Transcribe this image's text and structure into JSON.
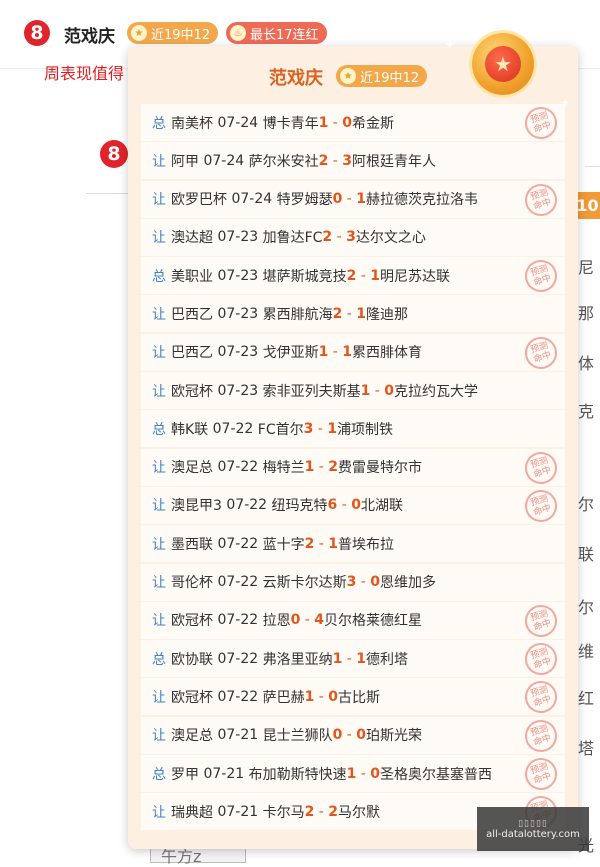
{
  "header": {
    "name": "范戏庆",
    "badge_recent": "近19中12",
    "badge_streak": "最长17连红"
  },
  "background": {
    "red_text": "周表现值得",
    "right_badge": "10",
    "right_chars": [
      "尼",
      "那",
      "体",
      "克",
      "尔",
      "联",
      "尔",
      "维",
      "红",
      "塔",
      "光"
    ],
    "bottom_left": "午方z"
  },
  "popup": {
    "title": "范戏庆",
    "badge": "近19中12",
    "stamp_text": "预测命中",
    "rows": [
      {
        "tag": "总",
        "league": "南美杯",
        "date": "07-24",
        "home": "博卡青年",
        "hs": "1",
        "as": "0",
        "away": "希金斯",
        "hit": true
      },
      {
        "tag": "让",
        "league": "阿甲",
        "date": "07-24",
        "home": "萨尔米安社",
        "hs": "2",
        "as": "3",
        "away": "阿根廷青年人",
        "hit": false
      },
      {
        "tag": "让",
        "league": "欧罗巴杯",
        "date": "07-24",
        "home": "特罗姆瑟",
        "hs": "0",
        "as": "1",
        "away": "赫拉德茨克拉洛韦",
        "hit": true
      },
      {
        "tag": "让",
        "league": "澳达超",
        "date": "07-23",
        "home": "加鲁达FC",
        "hs": "2",
        "as": "3",
        "away": "达尔文之心",
        "hit": false
      },
      {
        "tag": "总",
        "league": "美职业",
        "date": "07-23",
        "home": "堪萨斯城竞技",
        "hs": "2",
        "as": "1",
        "away": "明尼苏达联",
        "hit": true
      },
      {
        "tag": "让",
        "league": "巴西乙",
        "date": "07-23",
        "home": "累西腓航海",
        "hs": "2",
        "as": "1",
        "away": "隆迪那",
        "hit": false
      },
      {
        "tag": "让",
        "league": "巴西乙",
        "date": "07-23",
        "home": "戈伊亚斯",
        "hs": "1",
        "as": "1",
        "away": "累西腓体育",
        "hit": true
      },
      {
        "tag": "让",
        "league": "欧冠杯",
        "date": "07-23",
        "home": "索非亚列夫斯基",
        "hs": "1",
        "as": "0",
        "away": "克拉约瓦大学",
        "hit": false
      },
      {
        "tag": "总",
        "league": "韩K联",
        "date": "07-22",
        "home": "FC首尔",
        "hs": "3",
        "as": "1",
        "away": "浦项制铁",
        "hit": false
      },
      {
        "tag": "让",
        "league": "澳足总",
        "date": "07-22",
        "home": "梅特兰",
        "hs": "1",
        "as": "2",
        "away": "费雷曼特尔市",
        "hit": true
      },
      {
        "tag": "让",
        "league": "澳昆甲3",
        "date": "07-22",
        "home": "纽玛克特",
        "hs": "6",
        "as": "0",
        "away": "北湖联",
        "hit": true
      },
      {
        "tag": "让",
        "league": "墨西联",
        "date": "07-22",
        "home": "蓝十字",
        "hs": "2",
        "as": "1",
        "away": "普埃布拉",
        "hit": false
      },
      {
        "tag": "让",
        "league": "哥伦杯",
        "date": "07-22",
        "home": "云斯卡尔达斯",
        "hs": "3",
        "as": "0",
        "away": "恩维加多",
        "hit": false
      },
      {
        "tag": "让",
        "league": "欧冠杯",
        "date": "07-22",
        "home": "拉恩",
        "hs": "0",
        "as": "4",
        "away": "贝尔格莱德红星",
        "hit": true
      },
      {
        "tag": "总",
        "league": "欧协联",
        "date": "07-22",
        "home": "弗洛里亚纳",
        "hs": "1",
        "as": "1",
        "away": "德利塔",
        "hit": true
      },
      {
        "tag": "让",
        "league": "欧冠杯",
        "date": "07-22",
        "home": "萨巴赫",
        "hs": "1",
        "as": "0",
        "away": "古比斯",
        "hit": true
      },
      {
        "tag": "让",
        "league": "澳足总",
        "date": "07-21",
        "home": "昆士兰狮队",
        "hs": "0",
        "as": "0",
        "away": "珀斯光荣",
        "hit": true
      },
      {
        "tag": "总",
        "league": "罗甲",
        "date": "07-21",
        "home": "布加勒斯特快速",
        "hs": "1",
        "as": "0",
        "away": "圣格奥尔基塞普西",
        "hit": true
      },
      {
        "tag": "让",
        "league": "瑞典超",
        "date": "07-21",
        "home": "卡尔马",
        "hs": "2",
        "as": "2",
        "away": "马尔默",
        "hit": true
      }
    ]
  },
  "watermark": {
    "top": "▯▯▯▯▯",
    "url": "all-datalottery.com"
  }
}
